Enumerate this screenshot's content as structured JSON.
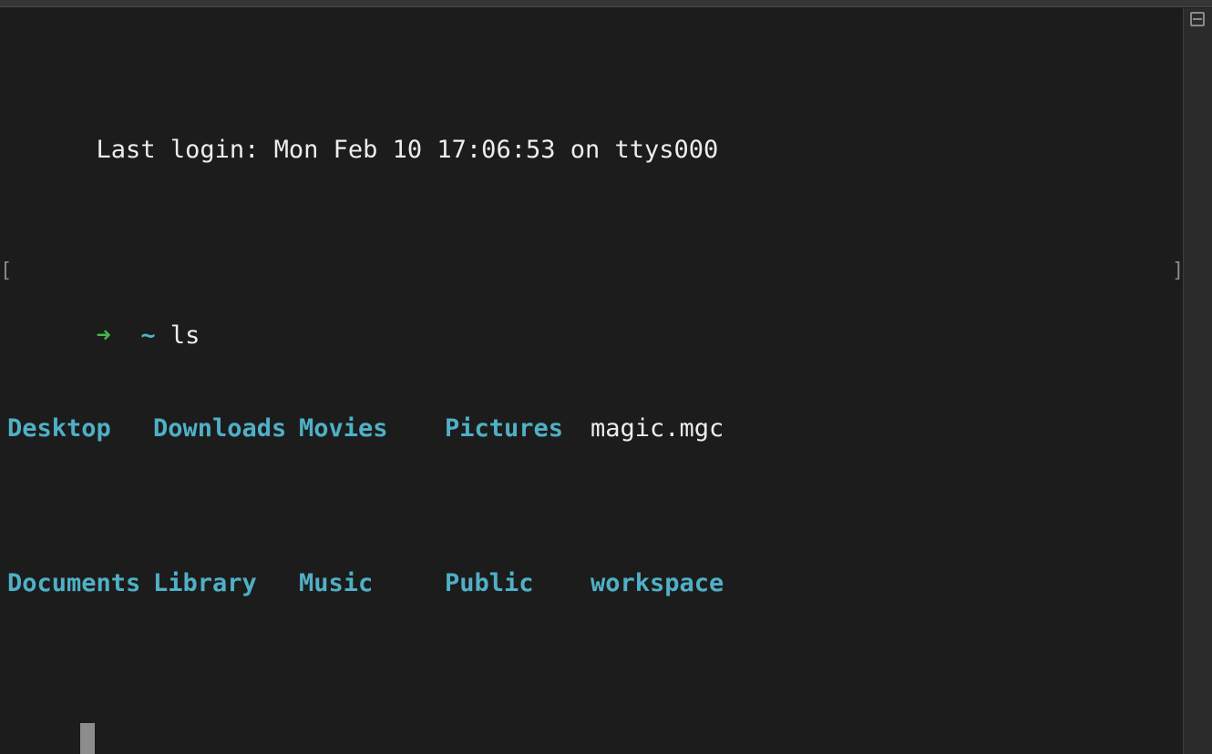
{
  "terminal": {
    "last_login": "Last login: Mon Feb 10 17:06:53 on ttys000",
    "prompt_arrow": "➜",
    "prompt_dir": "~",
    "command": "ls",
    "listing": {
      "row1": [
        "Desktop",
        "Downloads",
        "Movies",
        "Pictures",
        "magic.mgc"
      ],
      "row2": [
        "Documents",
        "Library",
        "Music",
        "Public",
        "workspace"
      ]
    },
    "mark_open": "[",
    "mark_close": "]"
  },
  "icons": {
    "scrollbar_toggle": "split-pane-icon",
    "cursor": "block-cursor"
  },
  "colors": {
    "background": "#1c1c1c",
    "text": "#ededed",
    "prompt_arrow": "#47b54a",
    "directory": "#4fb0c6",
    "cursor": "#8c8c8c"
  }
}
